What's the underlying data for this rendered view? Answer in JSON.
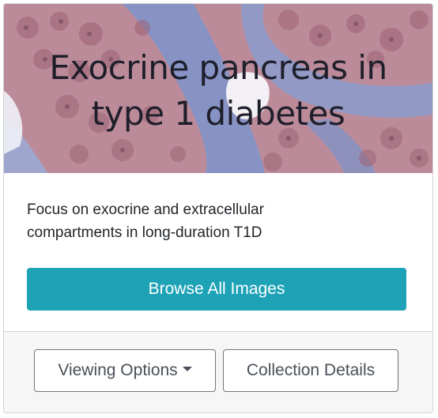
{
  "card": {
    "hero": {
      "title_line1": "Exocrine pancreas in",
      "title_line2": "type 1 diabetes",
      "image_description": "histology-tissue-image"
    },
    "description_line1": "Focus on exocrine and extracellular",
    "description_line2": "compartments in long-duration T1D",
    "browse_label": "Browse All Images",
    "footer": {
      "viewing_options_label": "Viewing Options",
      "collection_details_label": "Collection Details"
    }
  },
  "colors": {
    "primary_button": "#1da2b6",
    "tissue_pink": "#b57a8c",
    "tissue_blue": "#5a7fc0",
    "footer_bg": "#f6f6f6"
  }
}
